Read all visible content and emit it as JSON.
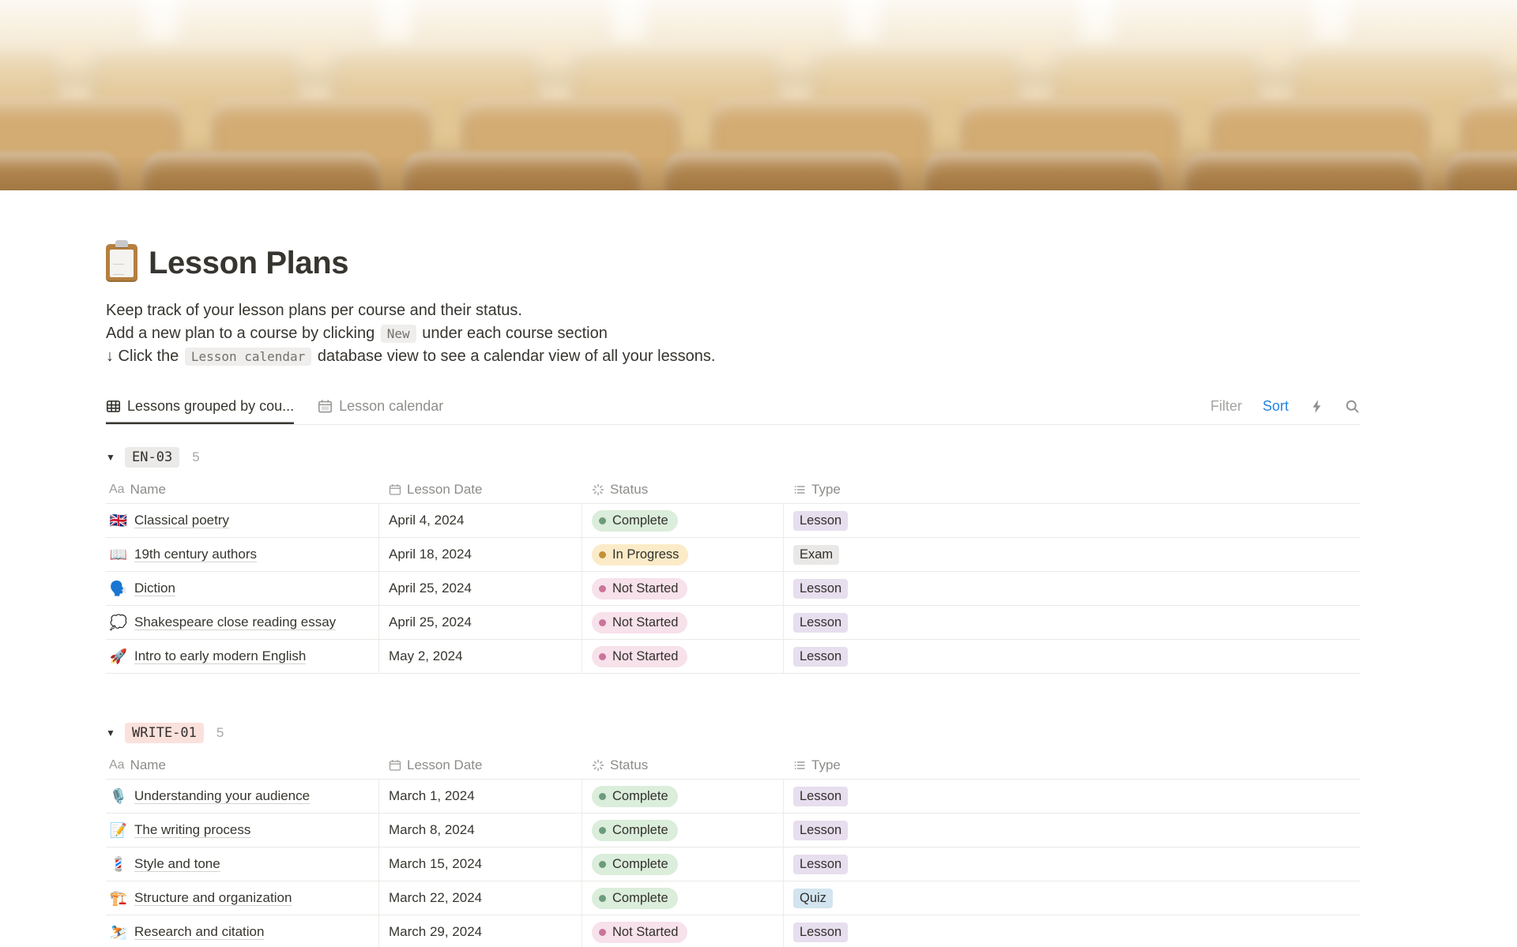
{
  "page": {
    "icon_name": "clipboard-emoji",
    "title": "Lesson Plans"
  },
  "description": {
    "line1": "Keep track of your lesson plans per course and their status.",
    "line2_prefix": "Add a new plan to a course by clicking",
    "line2_code": "New",
    "line2_suffix": "under each course section",
    "line3_prefix": "↓ Click the",
    "line3_code": "Lesson calendar",
    "line3_suffix": "database view to see a calendar view of all your lessons."
  },
  "toolbar": {
    "tabs": [
      {
        "label": "Lessons grouped by cou...",
        "icon": "table-icon",
        "active": true
      },
      {
        "label": "Lesson calendar",
        "icon": "calendar-icon",
        "active": false
      }
    ],
    "filter_label": "Filter",
    "sort_label": "Sort",
    "icons": [
      "lightning-icon",
      "search-icon"
    ]
  },
  "table": {
    "columns": [
      {
        "label": "Name",
        "icon": "aa"
      },
      {
        "label": "Lesson Date",
        "icon": "calendar"
      },
      {
        "label": "Status",
        "icon": "status"
      },
      {
        "label": "Type",
        "icon": "list"
      }
    ]
  },
  "status_styles": {
    "Complete": {
      "bg": "#DBEDDB",
      "dot": "#6C9B7D"
    },
    "In Progress": {
      "bg": "#FBEBC8",
      "dot": "#C19138"
    },
    "Not Started": {
      "bg": "#F7E1EA",
      "dot": "#C9749B"
    }
  },
  "type_styles": {
    "Lesson": "#E7DEEE",
    "Exam": "#E9E8E6",
    "Quiz": "#D2E4EF"
  },
  "groups": [
    {
      "name": "EN-03",
      "count": "5",
      "badge_bg": "#EBEAE8",
      "rows": [
        {
          "emoji": "🇬🇧",
          "emoji_name": "uk-flag",
          "name": "Classical poetry",
          "date": "April 4, 2024",
          "status": "Complete",
          "type": "Lesson"
        },
        {
          "emoji": "📖",
          "emoji_name": "open-book",
          "name": "19th century authors",
          "date": "April 18, 2024",
          "status": "In Progress",
          "type": "Exam"
        },
        {
          "emoji": "🗣️",
          "emoji_name": "speaking-head",
          "name": "Diction",
          "date": "April 25, 2024",
          "status": "Not Started",
          "type": "Lesson"
        },
        {
          "emoji": "💭",
          "emoji_name": "thought-balloon",
          "name": "Shakespeare close reading essay",
          "date": "April 25, 2024",
          "status": "Not Started",
          "type": "Lesson"
        },
        {
          "emoji": "🚀",
          "emoji_name": "rocket",
          "name": "Intro to early modern English",
          "date": "May 2, 2024",
          "status": "Not Started",
          "type": "Lesson"
        }
      ]
    },
    {
      "name": "WRITE-01",
      "count": "5",
      "badge_bg": "#FBE1DC",
      "rows": [
        {
          "emoji": "🎙️",
          "emoji_name": "studio-microphone",
          "name": "Understanding your audience",
          "date": "March 1, 2024",
          "status": "Complete",
          "type": "Lesson"
        },
        {
          "emoji": "📝",
          "emoji_name": "memo",
          "name": "The writing process",
          "date": "March 8, 2024",
          "status": "Complete",
          "type": "Lesson"
        },
        {
          "emoji": "💈",
          "emoji_name": "barber-pole",
          "name": "Style and tone",
          "date": "March 15, 2024",
          "status": "Complete",
          "type": "Lesson"
        },
        {
          "emoji": "🏗️",
          "emoji_name": "building-construction",
          "name": "Structure and organization",
          "date": "March 22, 2024",
          "status": "Complete",
          "type": "Quiz"
        },
        {
          "emoji": "⛷️",
          "emoji_name": "skier",
          "name": "Research and citation",
          "date": "March 29, 2024",
          "status": "Not Started",
          "type": "Lesson"
        }
      ]
    }
  ]
}
